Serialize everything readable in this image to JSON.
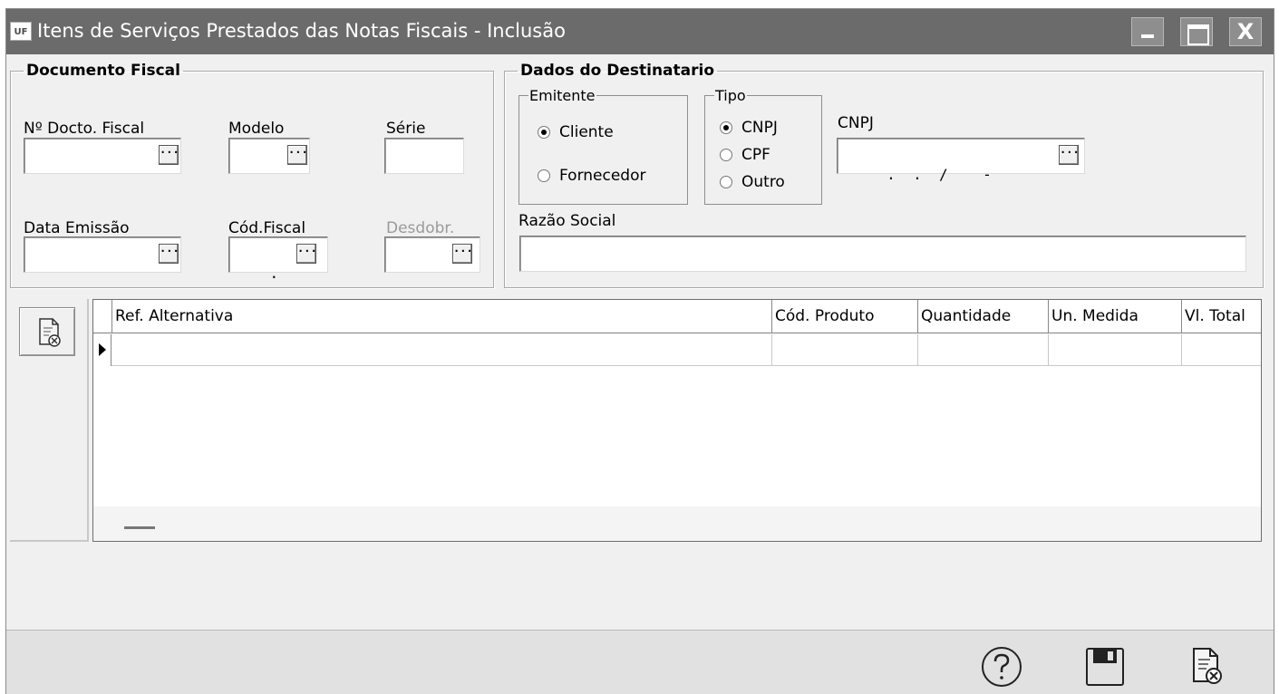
{
  "window": {
    "logo_text": "UF",
    "title": "Itens de Serviços Prestados das Notas Fiscais - Inclusão",
    "close_glyph": "X"
  },
  "documento_fiscal": {
    "legend": "Documento Fiscal",
    "n_docto_label": "Nº Docto. Fiscal",
    "n_docto_value": "",
    "modelo_label": "Modelo",
    "modelo_value": "",
    "serie_label": "Série",
    "serie_value": "",
    "data_emissao_label": "Data Emissão",
    "data_emissao_value": "",
    "cod_fiscal_label": "Cód.Fiscal",
    "cod_fiscal_value": ".",
    "desdobr_label": "Desdobr.",
    "desdobr_value": ""
  },
  "destinatario": {
    "legend": "Dados do Destinatario",
    "emitente": {
      "legend": "Emitente",
      "options": [
        "Cliente",
        "Fornecedor"
      ],
      "selected": "Cliente"
    },
    "tipo": {
      "legend": "Tipo",
      "options": [
        "CNPJ",
        "CPF",
        "Outro"
      ],
      "selected": "CNPJ"
    },
    "cnpj_label": "CNPJ",
    "cnpj_value": " .  .  /    -",
    "razao_social_label": "Razão Social",
    "razao_social_value": ""
  },
  "grid": {
    "columns": [
      "Ref. Alternativa",
      "Cód. Produto",
      "Quantidade",
      "Un. Medida",
      "Vl. Total"
    ],
    "rows": [
      [
        "",
        "",
        "",
        "",
        ""
      ]
    ]
  },
  "buttons": {
    "ellipsis": "···",
    "help_icon": "question-circle-icon",
    "save_icon": "floppy-disk-icon",
    "cancel_icon": "document-cancel-icon"
  },
  "colors": {
    "titlebar": "#6b6b6b",
    "window_bg": "#f0f0f0",
    "status_bar": "#e1e1e1"
  }
}
